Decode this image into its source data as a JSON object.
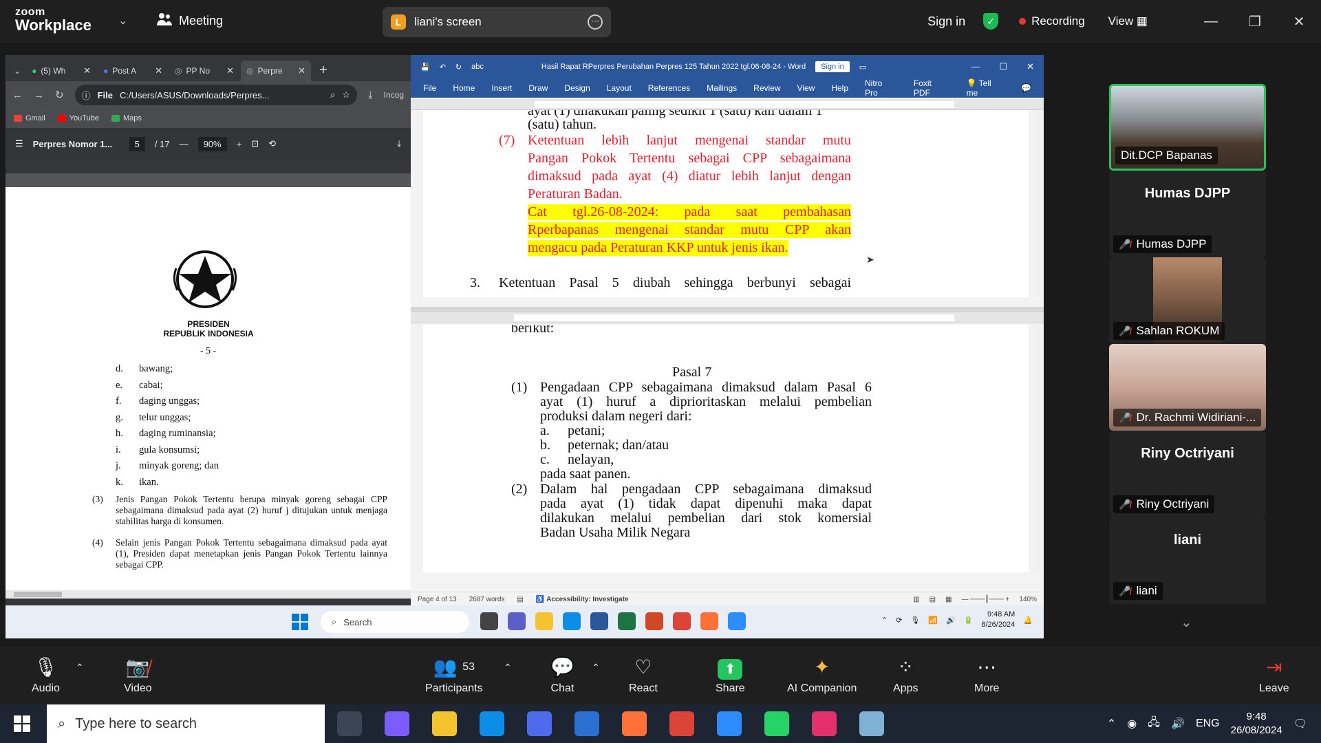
{
  "zoom": {
    "logo_line1": "zoom",
    "logo_line2": "Workplace",
    "meeting_label": "Meeting",
    "screen_badge": "L",
    "screen_label": "liani's screen",
    "sign_in": "Sign in",
    "recording": "Recording",
    "view": "View"
  },
  "browser": {
    "tabs": [
      {
        "label": "(5) Wh"
      },
      {
        "label": "Post A"
      },
      {
        "label": "PP No"
      },
      {
        "label": "Perpre"
      }
    ],
    "address_scheme": "File",
    "address": "C:/Users/ASUS/Downloads/Perpres...",
    "incognito": "Incog",
    "bookmarks": [
      "Gmail",
      "YouTube",
      "Maps"
    ]
  },
  "pdf": {
    "title": "Perpres Nomor 1...",
    "page_current": "5",
    "page_total": "/ 17",
    "zoom": "90%",
    "presiden_line1": "PRESIDEN",
    "presiden_line2": "REPUBLIK INDONESIA",
    "page_number": "- 5 -",
    "list": [
      {
        "letter": "d.",
        "text": "bawang;"
      },
      {
        "letter": "e.",
        "text": "cabai;"
      },
      {
        "letter": "f.",
        "text": "daging unggas;"
      },
      {
        "letter": "g.",
        "text": "telur unggas;"
      },
      {
        "letter": "h.",
        "text": "daging ruminansia;"
      },
      {
        "letter": "i.",
        "text": "gula konsumsi;"
      },
      {
        "letter": "j.",
        "text": "minyak goreng; dan"
      },
      {
        "letter": "k.",
        "text": "ikan."
      }
    ],
    "para3_num": "(3)",
    "para3": "Jenis Pangan Pokok Tertentu berupa minyak goreng sebagai CPP sebagaimana dimaksud pada ayat (2) huruf j ditujukan untuk menjaga stabilitas harga di konsumen.",
    "para4_num": "(4)",
    "para4": "Selain jenis Pangan Pokok Tertentu sebagaimana dimaksud pada ayat (1), Presiden dapat menetapkan jenis Pangan Pokok Tertentu lainnya sebagai CPP."
  },
  "word": {
    "filename": "Hasil Rapat RPerpres Perubahan Perpres 125 Tahun 2022 tgl.06-08-24 - Word",
    "sign_in": "Sign in",
    "menu": [
      "File",
      "Home",
      "Insert",
      "Draw",
      "Design",
      "Layout",
      "References",
      "Mailings",
      "Review",
      "View",
      "Help",
      "Nitro Pro",
      "Foxit PDF",
      "Tell me"
    ],
    "doc1": {
      "cut_line": "ayat (1) dilakukan paling sedikit 1 (satu) kali dalam 1",
      "line_a": "(satu) tahun.",
      "num7": "(7)",
      "red1": "Ketentuan lebih lanjut mengenai standar mutu",
      "red2": "Pangan Pokok Tertentu sebagai CPP sebagaimana",
      "red3": "dimaksud pada ayat (4) diatur lebih lanjut dengan",
      "red4": "Peraturan Badan.",
      "hl1": "Cat tgl.26-08-2024: pada saat pembahasan",
      "hl2": "Rperbapanas mengenai standar mutu CPP akan",
      "hl3": "mengacu pada Peraturan KKP untuk jenis ikan.",
      "num3": "3.",
      "pasal5": "Ketentuan Pasal 5 diubah sehingga berbunyi sebagai"
    },
    "doc2": {
      "berikut": "berikut:",
      "pasal7": "Pasal 7",
      "n1": "(1)",
      "p1a": "Pengadaan CPP sebagaimana dimaksud dalam Pasal 6",
      "p1b": "ayat (1) huruf a diprioritaskan melalui pembelian",
      "p1c": "produksi dalam negeri dari:",
      "la": "a.",
      "ta": "petani;",
      "lb": "b.",
      "tb": "peternak; dan/atau",
      "lc": "c.",
      "tc": "nelayan,",
      "p1d": "pada saat panen.",
      "n2": "(2)",
      "p2a": "Dalam hal pengadaan CPP sebagaimana dimaksud",
      "p2b": "pada ayat (1) tidak dapat dipenuhi maka dapat",
      "p2c": "dilakukan melalui pembelian dari stok komersial",
      "p2d": "Badan Usaha Milik Negara"
    },
    "status_page": "Page 4 of 13",
    "status_words": "2687 words",
    "status_accessibility": "Accessibility: Investigate",
    "status_zoom": "140%"
  },
  "inner_taskbar": {
    "search": "Search",
    "time": "9:48 AM",
    "date": "8/26/2024"
  },
  "participants": [
    {
      "name": "Dit.DCP Bapanas",
      "type": "video",
      "active": true
    },
    {
      "name": "Humas DJPP",
      "type": "name"
    },
    {
      "name": "Sahlan ROKUM",
      "type": "video"
    },
    {
      "name": "Dr. Rachmi Widiriani-...",
      "type": "video"
    },
    {
      "name": "Riny Octriyani",
      "type": "name"
    },
    {
      "name": "liani",
      "type": "name"
    }
  ],
  "toolbar": {
    "audio": "Audio",
    "video": "Video",
    "participants": "Participants",
    "participants_count": "53",
    "chat": "Chat",
    "react": "React",
    "share": "Share",
    "ai": "AI Companion",
    "apps": "Apps",
    "more": "More",
    "leave": "Leave"
  },
  "host_taskbar": {
    "search_placeholder": "Type here to search",
    "lang": "ENG",
    "time": "9:48",
    "date": "26/08/2024"
  },
  "colors": {
    "doc_red": "#e5202e",
    "highlight": "#ffff00",
    "word_blue": "#2b579a",
    "active_speaker": "#22c55e"
  }
}
